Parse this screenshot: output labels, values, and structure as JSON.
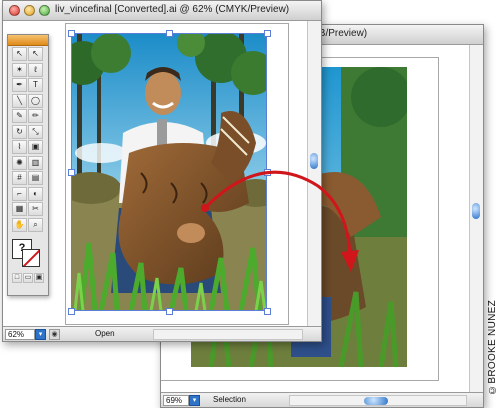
{
  "front_window": {
    "title": "liv_vincefinal [Converted].ai @ 62% (CMYK/Preview)",
    "zoom": "62%",
    "status_text": "Open"
  },
  "back_window": {
    "title_fragment": "GB/Preview)",
    "zoom": "69%",
    "status_text": "Selection"
  },
  "toolbox": {
    "tools": [
      {
        "icon": "selection-arrow-icon",
        "glyph": "↖"
      },
      {
        "icon": "direct-selection-icon",
        "glyph": "↖"
      },
      {
        "icon": "magic-wand-icon",
        "glyph": "✶"
      },
      {
        "icon": "lasso-icon",
        "glyph": "ℓ"
      },
      {
        "icon": "pen-icon",
        "glyph": "✒"
      },
      {
        "icon": "type-icon",
        "glyph": "T"
      },
      {
        "icon": "line-icon",
        "glyph": "╲"
      },
      {
        "icon": "ellipse-icon",
        "glyph": "◯"
      },
      {
        "icon": "paintbrush-icon",
        "glyph": "✎"
      },
      {
        "icon": "pencil-icon",
        "glyph": "✏"
      },
      {
        "icon": "rotate-icon",
        "glyph": "↻"
      },
      {
        "icon": "scale-icon",
        "glyph": "⤡"
      },
      {
        "icon": "warp-icon",
        "glyph": "⌇"
      },
      {
        "icon": "free-transform-icon",
        "glyph": "▣"
      },
      {
        "icon": "symbol-sprayer-icon",
        "glyph": "✺"
      },
      {
        "icon": "graph-icon",
        "glyph": "▥"
      },
      {
        "icon": "mesh-icon",
        "glyph": "#"
      },
      {
        "icon": "gradient-icon",
        "glyph": "▤"
      },
      {
        "icon": "eyedropper-icon",
        "glyph": "⌐"
      },
      {
        "icon": "blend-icon",
        "glyph": "◐"
      },
      {
        "icon": "live-paint-icon",
        "glyph": "▦"
      },
      {
        "icon": "slice-icon",
        "glyph": "✂"
      },
      {
        "icon": "hand-icon",
        "glyph": "✋"
      },
      {
        "icon": "zoom-icon",
        "glyph": "⌕"
      }
    ],
    "fill_stroke_glyph": "?",
    "mode_buttons": [
      "□",
      "▭",
      "▣"
    ]
  },
  "credit": "©BROOKE NUNEZ",
  "colors": {
    "arrow": "#d0151b",
    "scroll_thumb": "#2d74c9",
    "selection": "#5b7fd6"
  }
}
